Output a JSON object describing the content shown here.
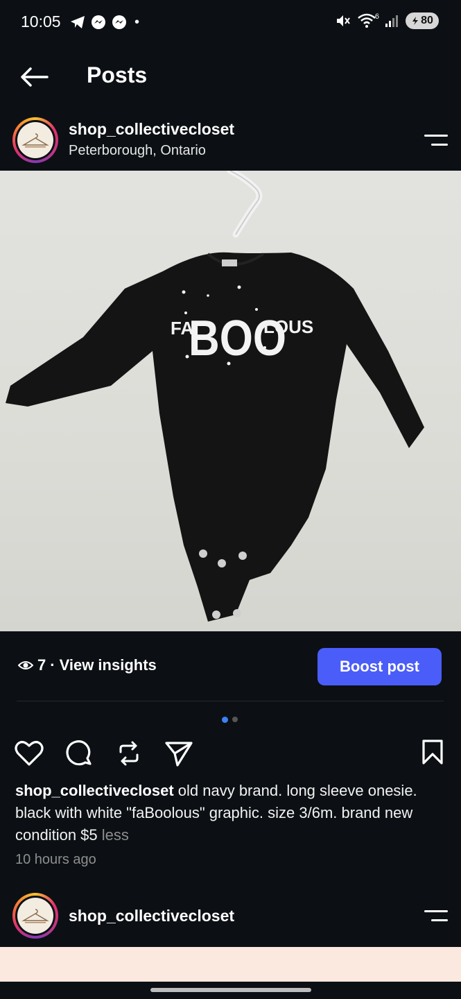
{
  "status_bar": {
    "time": "10:05",
    "dot": "•",
    "battery": "80",
    "network": "6"
  },
  "header": {
    "title": "Posts"
  },
  "post": {
    "username": "shop_collectivecloset",
    "location": "Peterborough, Ontario",
    "image": {
      "graphic_text_left": "FA",
      "graphic_text_main": "BOO",
      "graphic_text_right": "LOUS"
    },
    "insights": {
      "views": "7",
      "separator": "·",
      "label": "View insights"
    },
    "boost_label": "Boost post",
    "carousel": {
      "count": 2,
      "active_index": 0
    },
    "caption_username": "shop_collectivecloset",
    "caption_text": " old navy brand. long sleeve onesie. black with white \"faBoolous\" graphic. size 3/6m. brand new condition $5 ",
    "caption_more": "less",
    "time_ago": "10 hours ago"
  },
  "next_post": {
    "username": "shop_collectivecloset"
  },
  "colors": {
    "background": "#0c1014",
    "accent": "#4a5df9",
    "carousel_active": "#3b82f6",
    "muted_text": "#8e8e8e"
  }
}
